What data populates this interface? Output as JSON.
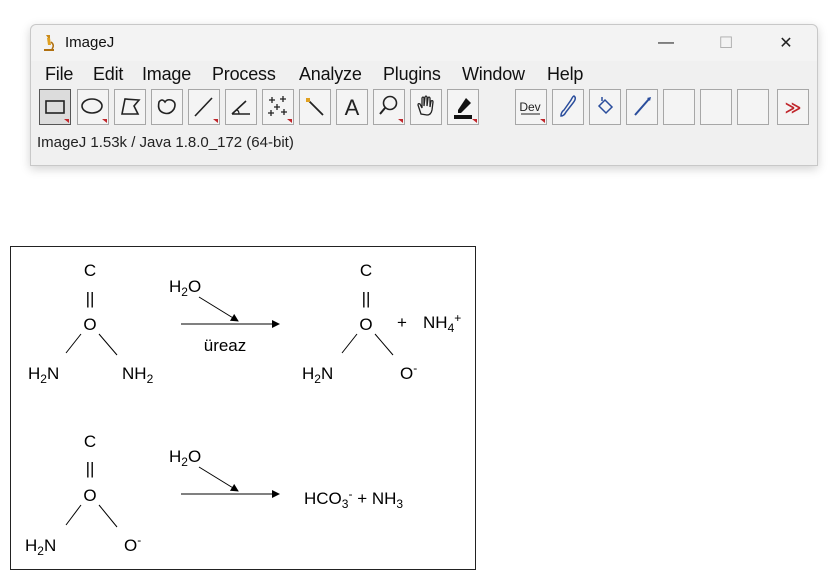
{
  "window": {
    "title": "ImageJ",
    "controls": {
      "minimize": "—",
      "maximize": "☐",
      "close": "✕"
    }
  },
  "menu": [
    "File",
    "Edit",
    "Image",
    "Process",
    "Analyze",
    "Plugins",
    "Window",
    "Help"
  ],
  "toolbar": {
    "tools": [
      "rectangle-tool",
      "oval-tool",
      "polygon-tool",
      "freehand-tool",
      "line-tool",
      "angle-tool",
      "multipoint-tool",
      "wand-tool",
      "text-tool",
      "magnifier-tool",
      "hand-tool",
      "color-picker-tool",
      "dev-menu",
      "paintbrush-tool",
      "flood-fill-tool",
      "pencil-tool",
      "empty-slot",
      "empty-slot",
      "empty-slot",
      "more-tools"
    ],
    "dev_label": "Dev",
    "text_tool_label": "A",
    "more_label": "≫"
  },
  "status": "ImageJ 1.53k / Java 1.8.0_172 (64-bit)",
  "diagram": {
    "row1": {
      "reactant": {
        "top": "C",
        "double_bond": "||",
        "center": "O",
        "left": "H",
        "left_sub": "2",
        "left_tail": "N",
        "right": "NH",
        "right_sub": "2"
      },
      "water": {
        "main": "H",
        "sub": "2",
        "tail": "O"
      },
      "enzyme": "üreaz",
      "product": {
        "top": "C",
        "double_bond": "||",
        "center": "O",
        "left": "H",
        "left_sub": "2",
        "left_tail": "N",
        "right": "O",
        "right_sup": "-"
      },
      "plus": "+",
      "ammonium": {
        "main": "NH",
        "sub": "4",
        "sup": "+"
      }
    },
    "row2": {
      "reactant": {
        "top": "C",
        "double_bond": "||",
        "center": "O",
        "left": "H",
        "left_sub": "2",
        "left_tail": "N",
        "right": "O",
        "right_sup": "-"
      },
      "water": {
        "main": "H",
        "sub": "2",
        "tail": "O"
      },
      "product": {
        "main": "HCO",
        "sub": "3",
        "sup": "-",
        "rest": " + NH",
        "rest_sub": "3"
      }
    }
  },
  "colors": {
    "accent_red": "#c0262b",
    "selected_tool": "#dcdcdc",
    "window_bg": "#f0f0f0"
  }
}
